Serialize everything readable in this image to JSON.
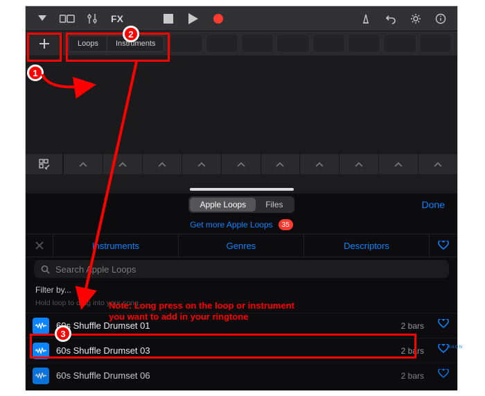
{
  "transport": {
    "fx_label": "FX"
  },
  "live_loops": {
    "tabs": {
      "loops": "Loops",
      "instruments": "Instruments"
    }
  },
  "browser": {
    "seg": {
      "apple_loops": "Apple Loops",
      "files": "Files"
    },
    "done": "Done",
    "promo": {
      "text": "Get more Apple Loops",
      "count": "35"
    },
    "categories": {
      "instruments": "Instruments",
      "genres": "Genres",
      "descriptors": "Descriptors"
    },
    "search_placeholder": "Search Apple Loops",
    "filter_label": "Filter by...",
    "drag_hint": "Hold loop to drag into your song.",
    "items": [
      {
        "name": "60s Shuffle Drumset 01",
        "length": "2 bars"
      },
      {
        "name": "60s Shuffle Drumset 03",
        "length": "2 bars"
      },
      {
        "name": "60s Shuffle Drumset 06",
        "length": "2 bars"
      }
    ]
  },
  "annotations": {
    "note_line1": "Note: Long press on the loop or instrument",
    "note_line2": "you want to add in your ringtone",
    "n1": "1",
    "n2": "2",
    "n3": "3"
  },
  "side_label": "RAON"
}
